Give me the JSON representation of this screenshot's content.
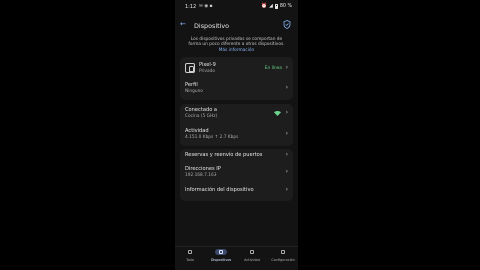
{
  "status_bar": {
    "time": "1:12",
    "battery": "80 %"
  },
  "app_bar": {
    "title": "Dispositivo"
  },
  "info": {
    "text": "Los dispositivos privados se comportan de forma un poco diferente a otros dispositivos.",
    "link": "Más información"
  },
  "device": {
    "name": "Pixel-9",
    "type": "Privado",
    "status": "En línea"
  },
  "profile": {
    "title": "Perfil",
    "value": "Ninguno"
  },
  "connection": {
    "title": "Conectado a",
    "value": "Cocina (5 GHz)"
  },
  "activity": {
    "title": "Actividad",
    "value": "4.151.0 Kbps ↑ 2.7 Kbps"
  },
  "settings": {
    "reservations": "Reservas y reenvío de puertos",
    "ip_title": "Direcciones IP",
    "ip_value": "192.168.7.163",
    "device_info": "Información del dispositivo"
  },
  "nav": {
    "items": [
      {
        "label": "Todo"
      },
      {
        "label": "Dispositivos"
      },
      {
        "label": "Actividad"
      },
      {
        "label": "Configuración"
      }
    ],
    "active_index": 1
  },
  "colors": {
    "accent": "#8ab4f8",
    "online": "#6dd58c",
    "card": "#1d1d1e",
    "background": "#131313"
  }
}
